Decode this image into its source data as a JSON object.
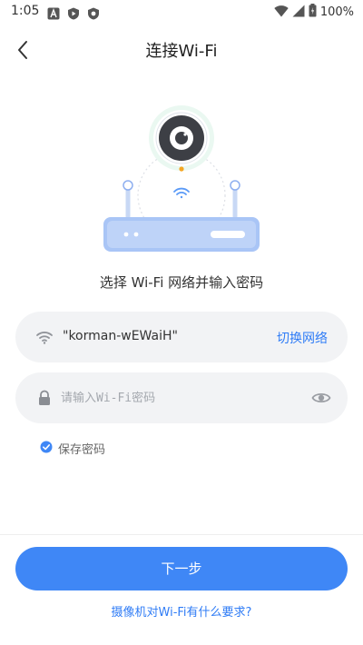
{
  "status_bar": {
    "time": "1:05",
    "battery": "100%",
    "icons": [
      "notification-a-icon",
      "play-protect-icon",
      "shield-icon",
      "wifi-icon",
      "cell-signal-icon",
      "battery-icon"
    ]
  },
  "header": {
    "title": "连接Wi-Fi",
    "back_icon": "chevron-left-icon"
  },
  "illustration": {
    "icons": [
      "camera-icon",
      "wifi-waves-icon",
      "router-icon"
    ],
    "accent": "#f5a623"
  },
  "instruction": "选择 Wi-Fi 网络并输入密码",
  "network": {
    "icon": "wifi-icon",
    "name": "\"korman-wEWaiH\"",
    "switch_label": "切换网络"
  },
  "password": {
    "icon": "lock-icon",
    "value": "",
    "placeholder": "请输入Wi-Fi密码",
    "toggle_icon": "eye-icon"
  },
  "save_password": {
    "label": "保存密码",
    "checked": true
  },
  "next_button": "下一步",
  "requirements_link": "摄像机对Wi-Fi有什么要求?",
  "colors": {
    "primary": "#3f87f6",
    "link": "#2f7cf6",
    "field_bg": "#f2f3f5"
  }
}
